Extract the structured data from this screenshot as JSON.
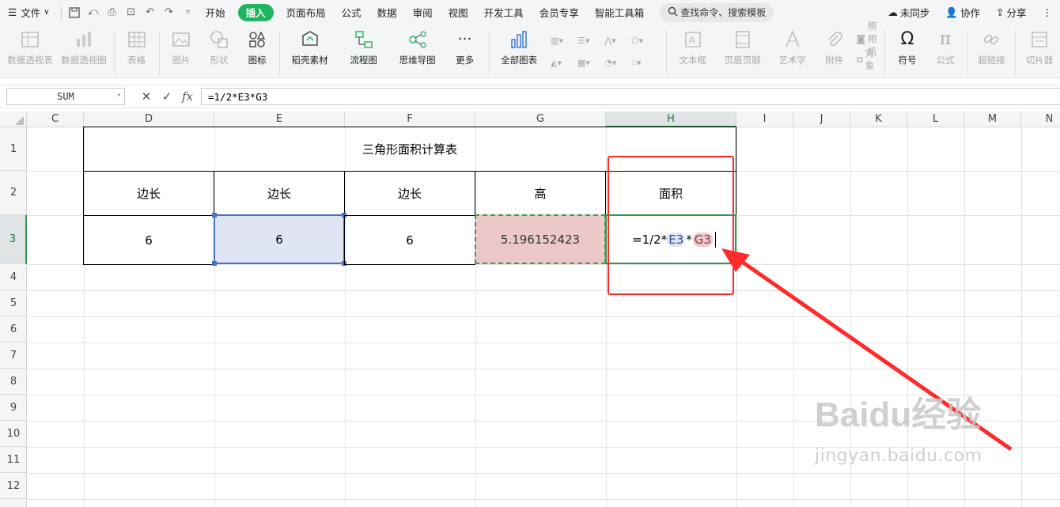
{
  "menubar": {
    "file": "文件",
    "tabs": [
      "开始",
      "插入",
      "页面布局",
      "公式",
      "数据",
      "审阅",
      "视图",
      "开发工具",
      "会员专享",
      "智能工具箱"
    ],
    "active_tab": "插入",
    "search": "查找命令、搜索模板",
    "sync": "未同步",
    "collab": "协作",
    "share": "分享"
  },
  "ribbon": {
    "pivot_table": "数据透视表",
    "pivot_chart": "数据透视图",
    "table": "表格",
    "picture": "图片",
    "shape": "形状",
    "icon": "图标",
    "material": "稻壳素材",
    "flowchart": "流程图",
    "mindmap": "思维导图",
    "more": "更多",
    "all_charts": "全部图表",
    "textbox": "文本框",
    "header_footer": "页眉页脚",
    "wordart": "艺术字",
    "attachment": "附件",
    "camera": "照相机",
    "object": "对象",
    "symbol": "符号",
    "formula": "公式",
    "hyperlink": "超链接",
    "slicer": "切片器"
  },
  "formula_bar": {
    "name_box": "SUM",
    "formula": "=1/2*E3*G3"
  },
  "columns": [
    "C",
    "D",
    "E",
    "F",
    "G",
    "H",
    "I",
    "J",
    "K",
    "L",
    "M",
    "N"
  ],
  "rows": [
    "1",
    "2",
    "3",
    "4",
    "5",
    "6",
    "7",
    "8",
    "9",
    "10",
    "11",
    "12"
  ],
  "sheet": {
    "title": "三角形面积计算表",
    "headers": [
      "边长",
      "边长",
      "边长",
      "高",
      "面积"
    ],
    "row3": {
      "D": "6",
      "E": "6",
      "F": "6",
      "G": "5.196152423"
    },
    "editing": {
      "prefix": "=1/2*",
      "ref1": "E3",
      "mid": "*",
      "ref2": "G3"
    }
  },
  "watermark": {
    "brand": "Baidu经验",
    "url": "jingyan.baidu.com"
  },
  "colors": {
    "accent": "#1fb55c",
    "ref1_fill": "#dfe5f5",
    "ref1_border": "#4a72c4",
    "ref2_fill": "#ecc8c8",
    "ref2_border": "#3d9a4e",
    "highlight": "#ff2a2a"
  }
}
